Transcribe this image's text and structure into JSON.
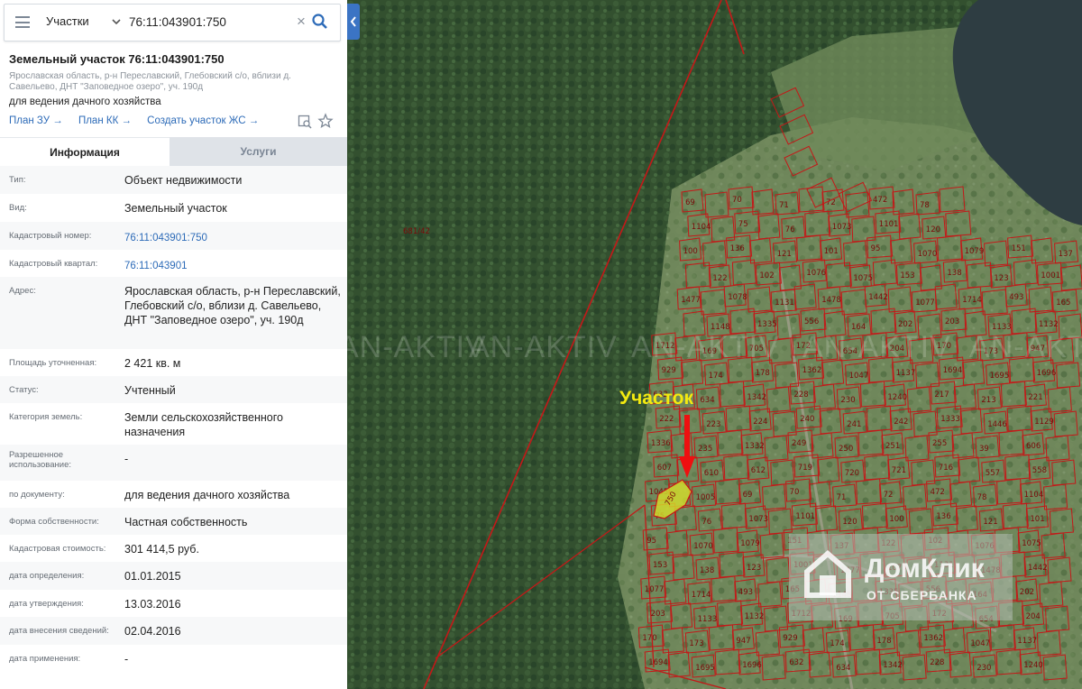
{
  "search": {
    "type_label": "Участки",
    "value": "76:11:043901:750",
    "icons": {
      "menu": "hamburger-icon",
      "chevron": "chevron-down-icon",
      "clear": "close-icon",
      "search": "search-icon"
    }
  },
  "parcel": {
    "title": "Земельный участок 76:11:043901:750",
    "address_short": "Ярославская область, р-н Переславский, Глебовский с/о, вблизи д. Савельево, ДНТ \"Заповедное озеро\", уч. 190д",
    "purpose": "для ведения дачного хозяйства",
    "links": [
      "План ЗУ →",
      "План КК →",
      "Создать участок ЖС →"
    ]
  },
  "tabs": {
    "info": "Информация",
    "services": "Услуги"
  },
  "info_rows": [
    {
      "label": "Тип:",
      "value": "Объект недвижимости"
    },
    {
      "label": "Вид:",
      "value": "Земельный участок"
    },
    {
      "label": "Кадастровый номер:",
      "value": "76:11:043901:750",
      "link": true
    },
    {
      "label": "Кадастровый квартал:",
      "value": "76:11:043901",
      "link": true
    },
    {
      "label": "Адрес:",
      "value": "Ярославская область, р-н Переславский, Глебовский с/о, вблизи д. Савельево, ДНТ \"Заповедное озеро\", уч. 190д"
    },
    {
      "label": "Площадь уточненная:",
      "value": "2 421 кв. м"
    },
    {
      "label": "Статус:",
      "value": "Учтенный"
    },
    {
      "label": "Категория земель:",
      "value": "Земли сельскохозяйственного назначения"
    },
    {
      "label": "Разрешенное использование:",
      "value": "-"
    },
    {
      "label": "по документу:",
      "value": "для ведения дачного хозяйства"
    },
    {
      "label": "Форма собственности:",
      "value": "Частная собственность"
    },
    {
      "label": "Кадастровая стоимость:",
      "value": "301 414,5 руб."
    },
    {
      "label": "дата определения:",
      "value": "01.01.2015"
    },
    {
      "label": "дата утверждения:",
      "value": "13.03.2016"
    },
    {
      "label": "дата внесения сведений:",
      "value": "02.04.2016"
    },
    {
      "label": "дата применения:",
      "value": "-"
    }
  ],
  "map": {
    "callout": "Участок",
    "selected_label": "750",
    "watermark": "AN-AKTIV",
    "forest_label": "681/42",
    "brand": "ДомКлик",
    "brand_sub": "ОТ СБЕРБАНКА",
    "colors": {
      "forest": "#2f4a2c",
      "water": "#2d3e44",
      "field": "#7e9366",
      "boundary": "#c41818",
      "selected": "#d7df2a",
      "arrow": "#ee1010"
    },
    "plot_labels": [
      "69",
      "70",
      "71",
      "72",
      "472",
      "78",
      "1104",
      "75",
      "76",
      "1073",
      "1101",
      "120",
      "100",
      "136",
      "121",
      "101",
      "95",
      "1070",
      "1079",
      "151",
      "137",
      "122",
      "102",
      "1076",
      "1075",
      "153",
      "138",
      "123",
      "1001",
      "1477",
      "1078",
      "1131",
      "1478",
      "1442",
      "1077",
      "1714",
      "493",
      "165",
      "1148",
      "1335",
      "556",
      "164",
      "202",
      "203",
      "1133",
      "1132",
      "1712",
      "169",
      "705",
      "172",
      "654",
      "204",
      "170",
      "173",
      "947",
      "929",
      "174",
      "178",
      "1362",
      "1047",
      "1137",
      "1694",
      "1695",
      "1696",
      "632",
      "634",
      "1342",
      "228",
      "230",
      "1240",
      "217",
      "213",
      "221",
      "222",
      "223",
      "224",
      "240",
      "241",
      "242",
      "1333",
      "1446",
      "1129",
      "1336",
      "235",
      "1332",
      "249",
      "250",
      "251",
      "255",
      "39",
      "606",
      "607",
      "610",
      "612",
      "719",
      "720",
      "721",
      "716",
      "557",
      "558",
      "1045",
      "1005"
    ]
  }
}
